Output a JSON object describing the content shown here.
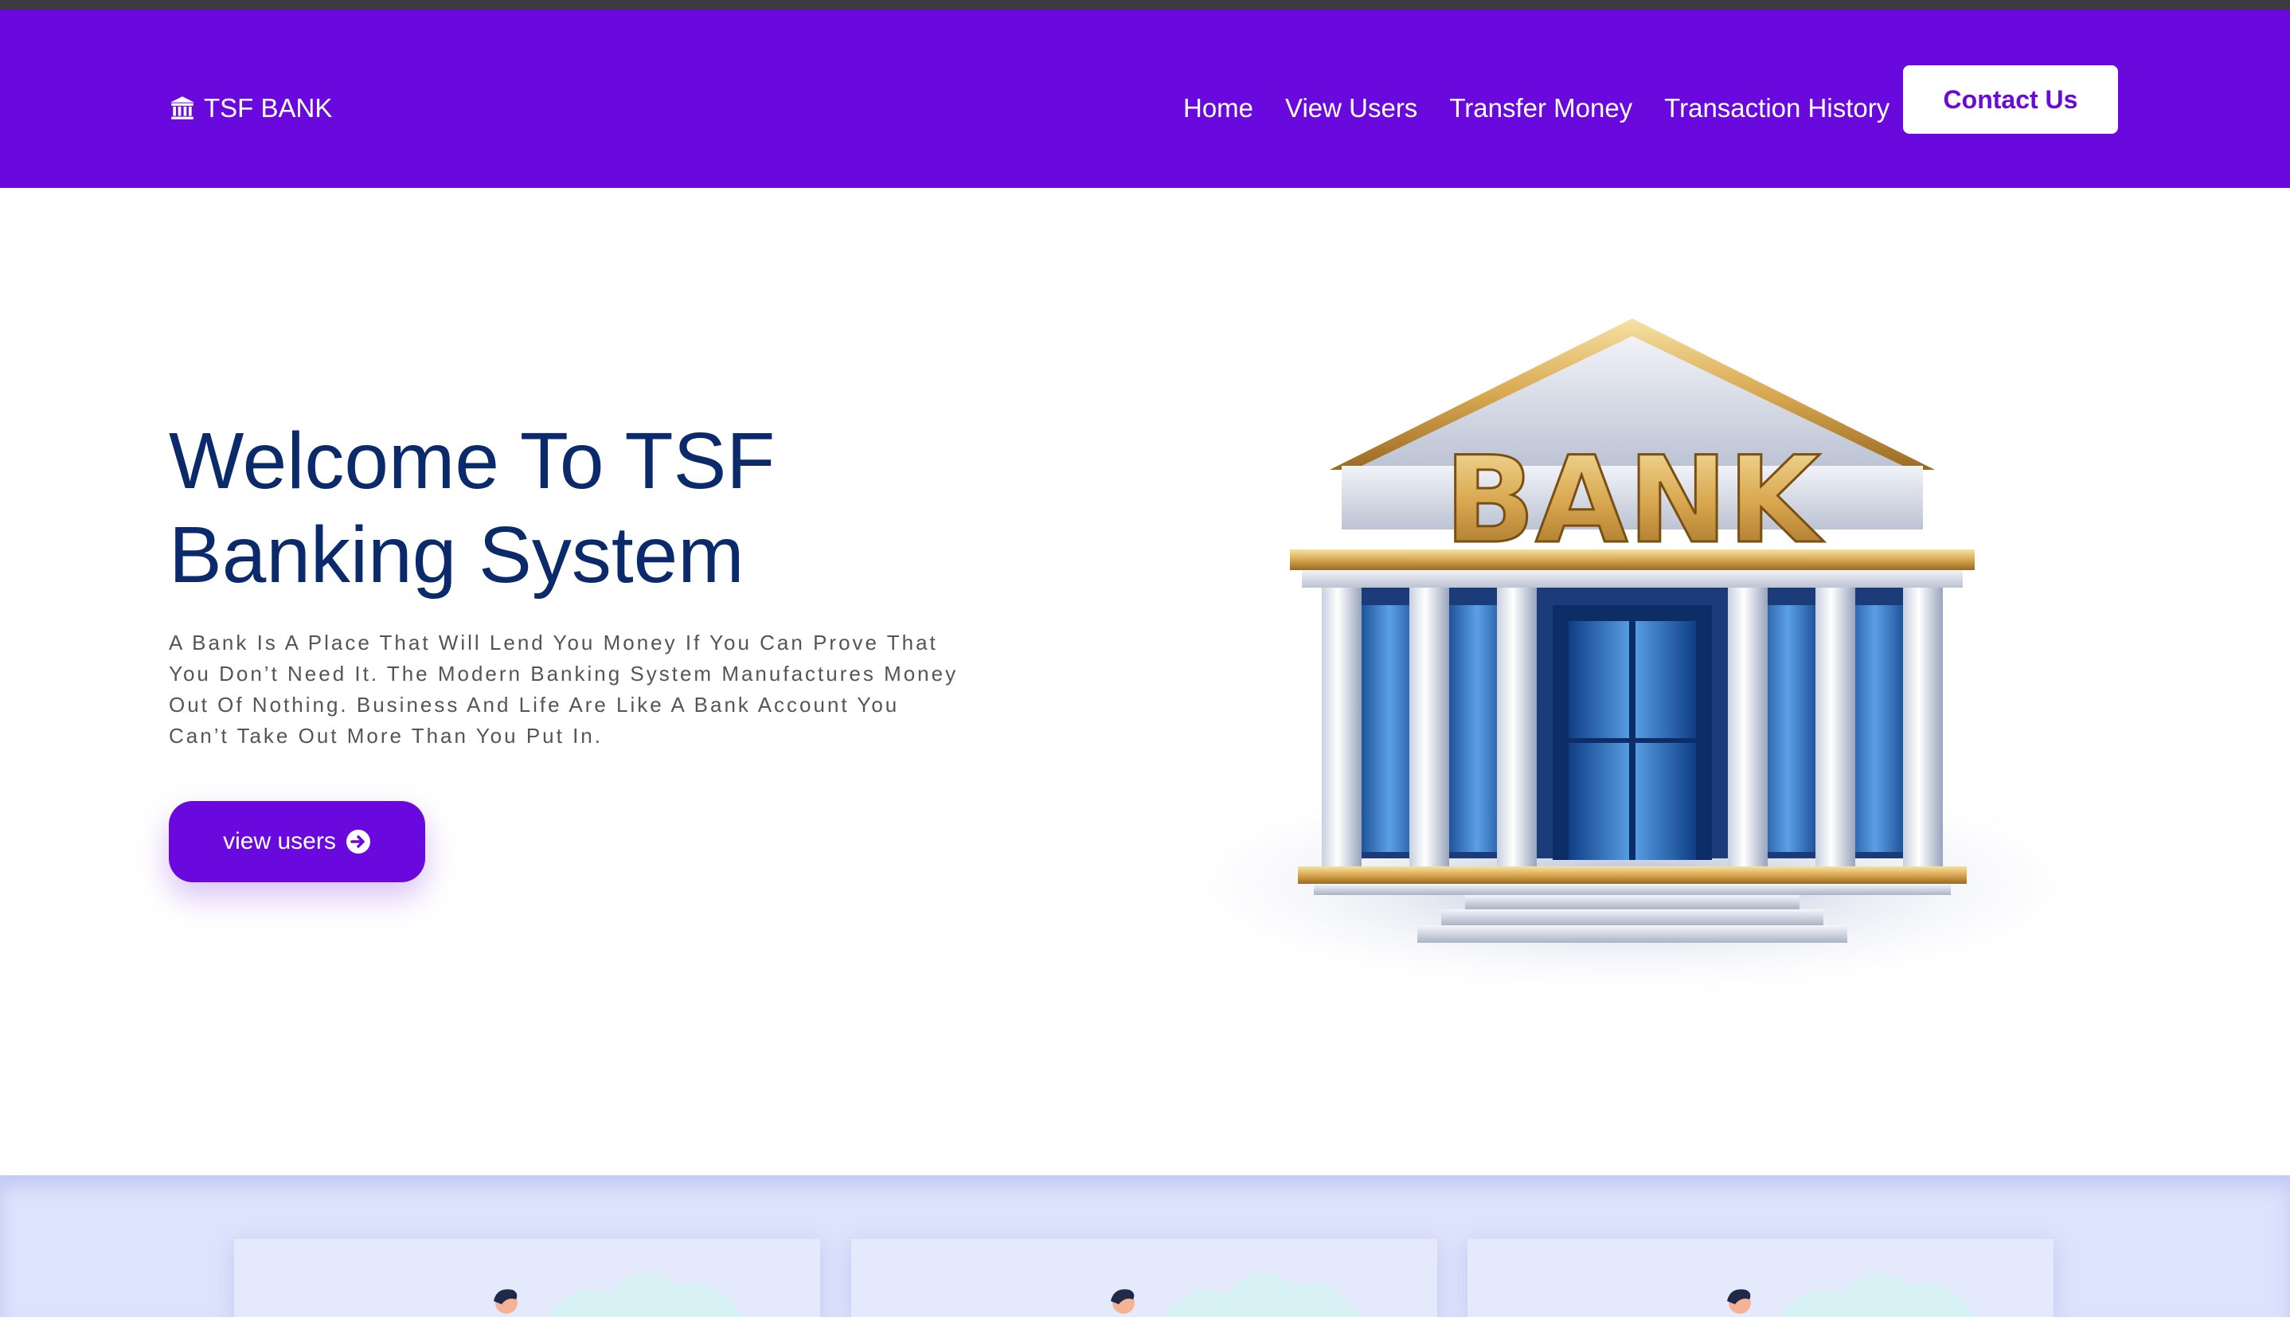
{
  "brand": {
    "name": "TSF BANK",
    "icon": "bank-icon"
  },
  "nav": {
    "items": [
      {
        "label": "Home"
      },
      {
        "label": "View Users"
      },
      {
        "label": "Transfer Money"
      },
      {
        "label": "Transaction History"
      }
    ],
    "contact_label": "Contact Us"
  },
  "hero": {
    "title": "Welcome To TSF Banking System",
    "description": "A Bank Is A Place That Will Lend You Money If You Can Prove That You Don’t Need It. The Modern Banking System Manufactures Money Out Of Nothing. Business And Life Are Like A Bank Account You Can’t Take Out More Than You Put In.",
    "button_label": "view users",
    "button_icon": "arrow-right-circle-icon",
    "image_label": "BANK"
  },
  "colors": {
    "primary": "#6909de",
    "title": "#0b2a6b",
    "text": "#555555",
    "section_bg": "#dde3fc"
  },
  "cards": [
    {
      "illustration": "person-illustration"
    },
    {
      "illustration": "person-illustration"
    },
    {
      "illustration": "person-illustration"
    }
  ]
}
